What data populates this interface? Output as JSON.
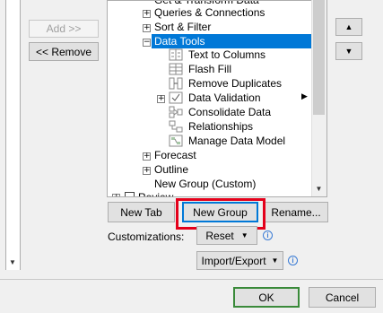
{
  "left": {
    "add_label": "Add >>",
    "remove_label": "<< Remove"
  },
  "tree": {
    "items": [
      {
        "label": "Get & Transform Data"
      },
      {
        "label": "Queries & Connections"
      },
      {
        "label": "Sort & Filter"
      },
      {
        "label": "Data Tools"
      },
      {
        "label": "Text to Columns"
      },
      {
        "label": "Flash Fill"
      },
      {
        "label": "Remove Duplicates"
      },
      {
        "label": "Data Validation"
      },
      {
        "label": "Consolidate Data"
      },
      {
        "label": "Relationships"
      },
      {
        "label": "Manage Data Model"
      },
      {
        "label": "Forecast"
      },
      {
        "label": "Outline"
      },
      {
        "label": "New Group (Custom)"
      },
      {
        "label": "Review"
      }
    ]
  },
  "buttons": {
    "new_tab": "New Tab",
    "new_group": "New Group",
    "rename": "Rename...",
    "customizations_label": "Customizations:",
    "reset": "Reset",
    "import_export": "Import/Export",
    "ok": "OK",
    "cancel": "Cancel"
  },
  "icons": {
    "move_up": "triangle-up-icon",
    "move_down": "triangle-down-icon",
    "info": "info-icon"
  },
  "colors": {
    "selection": "#0078d7",
    "highlight_outline": "#e4001b",
    "ok_border": "#3a8a3a"
  }
}
